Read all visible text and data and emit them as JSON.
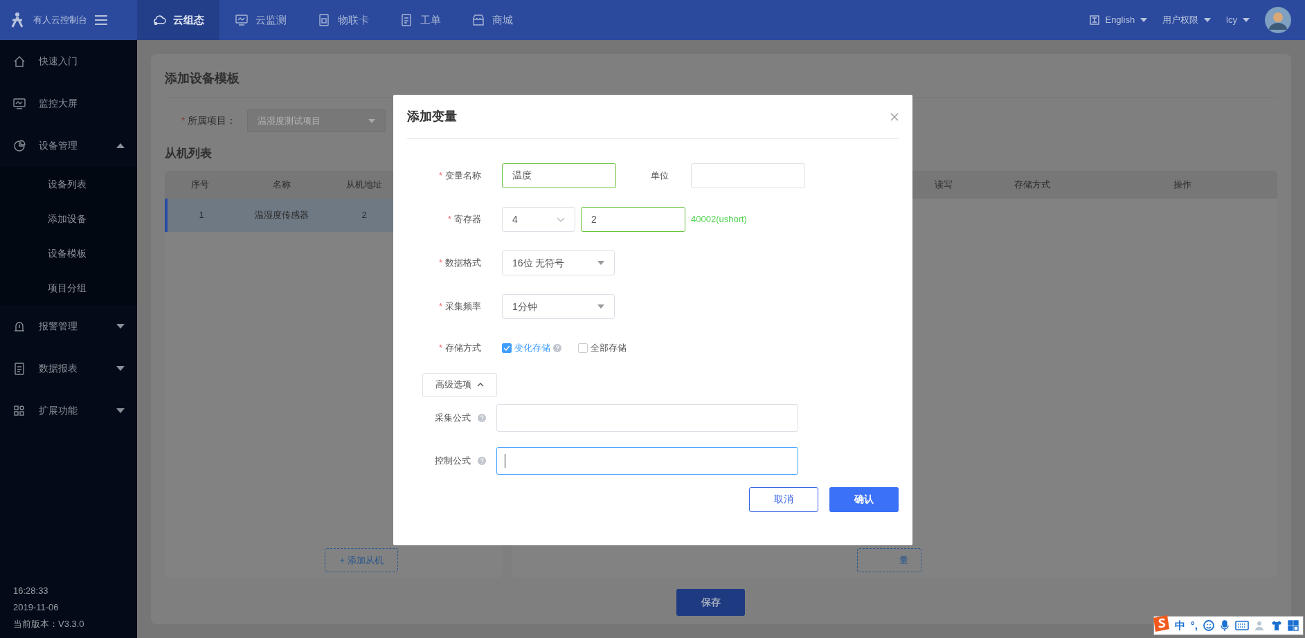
{
  "topbar": {
    "brand": "有人云控制台",
    "nav": [
      {
        "label": "云组态",
        "selected": true
      },
      {
        "label": "云监测",
        "selected": false
      },
      {
        "label": "物联卡",
        "selected": false
      },
      {
        "label": "工单",
        "selected": false
      },
      {
        "label": "商城",
        "selected": false
      }
    ],
    "language": "English",
    "permissions": "用户权限",
    "user": "lcy"
  },
  "sidebar": {
    "items": [
      {
        "label": "快速入门",
        "kind": "link"
      },
      {
        "label": "监控大屏",
        "kind": "link"
      },
      {
        "label": "设备管理",
        "kind": "group",
        "expanded": true,
        "children": [
          {
            "label": "设备列表"
          },
          {
            "label": "添加设备"
          },
          {
            "label": "设备模板"
          },
          {
            "label": "项目分组"
          }
        ]
      },
      {
        "label": "报警管理",
        "kind": "group",
        "expanded": false
      },
      {
        "label": "数据报表",
        "kind": "group",
        "expanded": false
      },
      {
        "label": "扩展功能",
        "kind": "group",
        "expanded": false
      }
    ],
    "time": "16:28:33",
    "date": "2019-11-06",
    "version": "当前版本：V3.3.0"
  },
  "page": {
    "title": "添加设备模板",
    "project": {
      "label": "所属项目：",
      "required_mark": "*",
      "value": "温湿度测试项目"
    },
    "slave_list": {
      "title": "从机列表",
      "columns": [
        "序号",
        "名称",
        "从机地址"
      ],
      "rows": [
        {
          "cells": [
            "1",
            "温湿度传感器",
            "2"
          ],
          "selected": true
        }
      ],
      "add_button": "+ 添加从机"
    },
    "variable_table": {
      "columns": [
        "读写",
        "存储方式",
        "操作"
      ],
      "add_button": "量"
    },
    "save_button": "保存"
  },
  "modal": {
    "title": "添加变量",
    "variable_name": {
      "label": "变量名称",
      "required_mark": "*",
      "value": "温度",
      "valid": true
    },
    "unit": {
      "label": "单位"
    },
    "register": {
      "label": "寄存器",
      "required_mark": "*",
      "type": "4",
      "address": "2",
      "valid": true,
      "hint": "40002(ushort)"
    },
    "data_format": {
      "label": "数据格式",
      "required_mark": "*",
      "value": "16位 无符号"
    },
    "frequency": {
      "label": "采集频率",
      "required_mark": "*",
      "value": "1分钟"
    },
    "storage": {
      "label": "存储方式",
      "required_mark": "*",
      "options": [
        {
          "label": "变化存储",
          "checked": true,
          "help": true
        },
        {
          "label": "全部存储",
          "checked": false,
          "help": false
        }
      ]
    },
    "advanced": {
      "label": "高级选项",
      "expanded": true
    },
    "collect_formula": {
      "label": "采集公式",
      "focused": false
    },
    "control_formula": {
      "label": "控制公式",
      "focused": true
    },
    "cancel": "取消",
    "confirm": "确认"
  },
  "ime": {
    "mode": "中",
    "punctuation": "°,"
  }
}
